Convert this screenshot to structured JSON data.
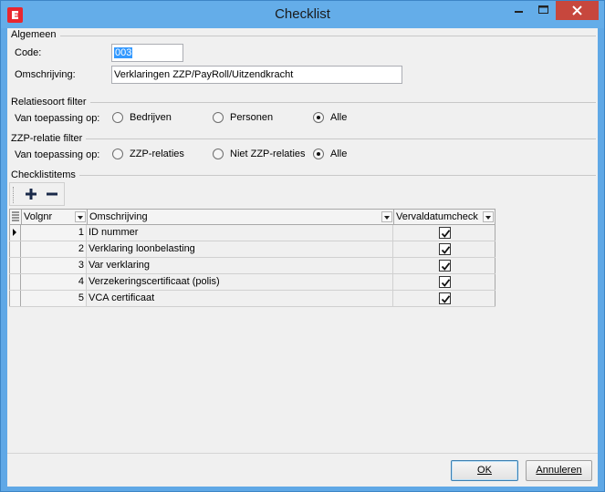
{
  "window": {
    "title": "Checklist"
  },
  "algemeen": {
    "section_label": "Algemeen",
    "code_label": "Code:",
    "code_value": "003",
    "omschrijving_label": "Omschrijving:",
    "omschrijving_value": "Verklaringen ZZP/PayRoll/Uitzendkracht"
  },
  "relatiesoort": {
    "section_label": "Relatiesoort filter",
    "applies_label": "Van toepassing op:",
    "options": [
      "Bedrijven",
      "Personen",
      "Alle"
    ],
    "selected": "Alle"
  },
  "zzp": {
    "section_label": "ZZP-relatie filter",
    "applies_label": "Van toepassing op:",
    "options": [
      "ZZP-relaties",
      "Niet ZZP-relaties",
      "Alle"
    ],
    "selected": "Alle"
  },
  "checklistitems": {
    "section_label": "Checklistitems",
    "toolbar": {
      "add_icon": "plus-icon",
      "remove_icon": "minus-icon"
    },
    "columns": [
      "Volgnr",
      "Omschrijving",
      "Vervaldatumcheck"
    ],
    "rows": [
      {
        "volgnr": "1",
        "omschrijving": "ID nummer",
        "check": true
      },
      {
        "volgnr": "2",
        "omschrijving": "Verklaring loonbelasting",
        "check": true
      },
      {
        "volgnr": "3",
        "omschrijving": "Var verklaring",
        "check": true
      },
      {
        "volgnr": "4",
        "omschrijving": "Verzekeringscertificaat (polis)",
        "check": true
      },
      {
        "volgnr": "5",
        "omschrijving": "VCA certificaat",
        "check": true
      }
    ]
  },
  "buttons": {
    "ok": "OK",
    "cancel": "Annuleren"
  },
  "colors": {
    "titlebar": "#64ade9",
    "close": "#c7473d",
    "app_icon": "#e8272f",
    "client_bg": "#f0f0f0"
  }
}
